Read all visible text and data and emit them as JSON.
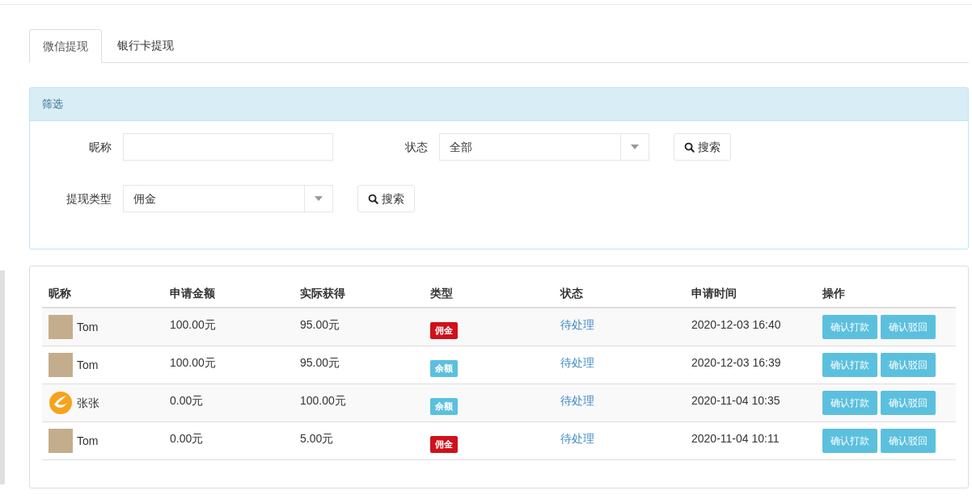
{
  "tabs": [
    {
      "label": "微信提现",
      "selected": true
    },
    {
      "label": "银行卡提现",
      "selected": false
    }
  ],
  "filter": {
    "title": "筛选",
    "nickname": {
      "label": "昵称"
    },
    "status": {
      "label": "状态",
      "value": "全部"
    },
    "type": {
      "label": "提现类型",
      "value": "佣金"
    },
    "search_buttons": [
      "搜索",
      "搜索"
    ]
  },
  "table": {
    "columns": [
      "昵称",
      "申请金额",
      "实际获得",
      "类型",
      "状态",
      "申请时间",
      "操作"
    ],
    "rows": [
      {
        "avatar": {
          "kind": "photo"
        },
        "nickname": "Tom",
        "amount": "100.00元",
        "actual": "95.00元",
        "type": {
          "label": "佣金",
          "kind": "commission"
        },
        "status": "待处理",
        "time": "2020-12-03 16:40",
        "actions": [
          "确认打款",
          "确认驳回"
        ]
      },
      {
        "avatar": {
          "kind": "photo"
        },
        "nickname": "Tom",
        "amount": "100.00元",
        "actual": "95.00元",
        "type": {
          "label": "余额",
          "kind": "balance"
        },
        "status": "待处理",
        "time": "2020-12-03 16:39",
        "actions": [
          "确认打款",
          "确认驳回"
        ]
      },
      {
        "avatar": {
          "kind": "logo"
        },
        "nickname": "张张",
        "amount": "0.00元",
        "actual": "100.00元",
        "type": {
          "label": "余额",
          "kind": "balance"
        },
        "status": "待处理",
        "time": "2020-11-04 10:35",
        "actions": [
          "确认打款",
          "确认驳回"
        ]
      },
      {
        "avatar": {
          "kind": "photo"
        },
        "nickname": "Tom",
        "amount": "0.00元",
        "actual": "5.00元",
        "type": {
          "label": "佣金",
          "kind": "commission"
        },
        "status": "待处理",
        "time": "2020-11-04 10:11",
        "actions": [
          "确认打款",
          "确认驳回"
        ]
      }
    ]
  }
}
